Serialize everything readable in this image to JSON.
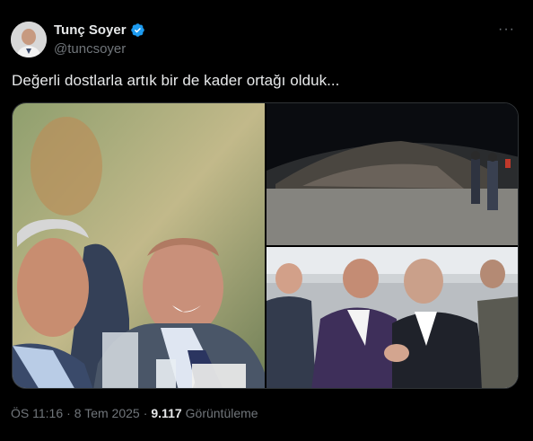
{
  "author": {
    "display_name": "Tunç Soyer",
    "handle": "@tuncsoyer",
    "verified_badge_color": "#1d9bf0",
    "verified_icon": "verified-badge-icon",
    "more_icon": "more-options-icon",
    "more_label": "···"
  },
  "tweet": {
    "text": "Değerli dostlarla artık bir de kader ortağı olduk...",
    "time": "ÖS 11:16",
    "separator": "·",
    "date": "8 Tem 2025",
    "views_count": "9.117",
    "views_label": "Görüntüleme"
  },
  "media": {
    "photos": [
      {
        "name": "photo-smiling-men-table"
      },
      {
        "name": "photo-rubble-night"
      },
      {
        "name": "photo-greeting-crowd"
      }
    ]
  },
  "colors": {
    "background": "#000000",
    "text_primary": "#e7e9ea",
    "text_secondary": "#71767b",
    "border": "#2f3336"
  }
}
